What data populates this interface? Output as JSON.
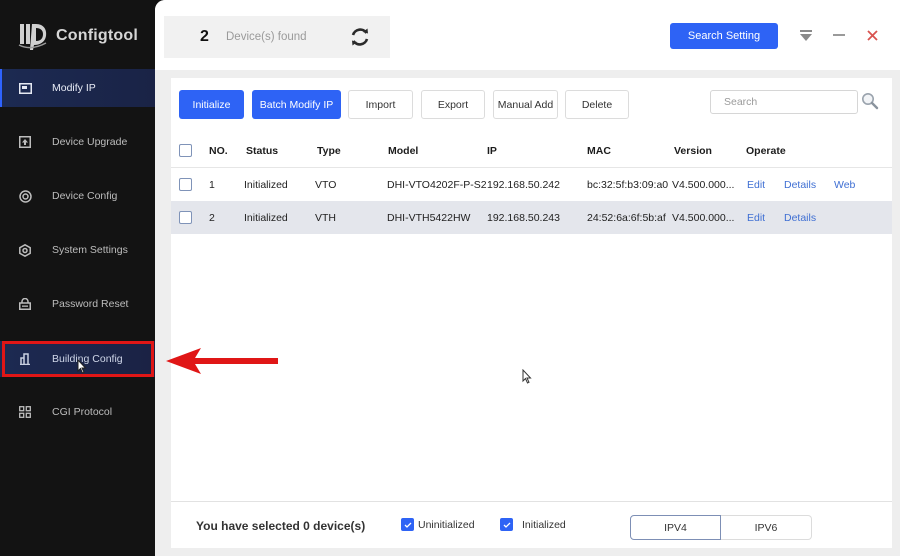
{
  "app": {
    "title": "Configtool"
  },
  "sidebar": {
    "items": [
      {
        "label": "Modify IP",
        "icon": "modify-ip-icon",
        "state": "active"
      },
      {
        "label": "Device Upgrade",
        "icon": "upgrade-icon",
        "state": "normal"
      },
      {
        "label": "Device Config",
        "icon": "device-config-icon",
        "state": "normal"
      },
      {
        "label": "System Settings",
        "icon": "system-settings-icon",
        "state": "normal"
      },
      {
        "label": "Password Reset",
        "icon": "lock-icon",
        "state": "normal"
      },
      {
        "label": "Building Config",
        "icon": "building-icon",
        "state": "hover-highlighted"
      },
      {
        "label": "CGI Protocol",
        "icon": "cgi-protocol-icon",
        "state": "normal"
      }
    ]
  },
  "topbar": {
    "device_count": "2",
    "device_count_label": "Device(s) found",
    "search_setting_label": "Search Setting"
  },
  "toolbar": {
    "initialize": "Initialize",
    "batch_modify_ip": "Batch Modify IP",
    "import": "Import",
    "export": "Export",
    "manual_add": "Manual Add",
    "delete": "Delete",
    "search_placeholder": "Search",
    "search_value": ""
  },
  "table": {
    "columns": [
      "NO.",
      "Status",
      "Type",
      "Model",
      "IP",
      "MAC",
      "Version",
      "Operate"
    ],
    "rows": [
      {
        "no": "1",
        "status": "Initialized",
        "type": "VTO",
        "model": "DHI-VTO4202F-P-S2",
        "ip": "192.168.50.242",
        "mac": "bc:32:5f:b3:09:a0",
        "version": "V4.500.000...",
        "ops": [
          "Edit",
          "Details",
          "Web"
        ],
        "checked": false
      },
      {
        "no": "2",
        "status": "Initialized",
        "type": "VTH",
        "model": "DHI-VTH5422HW",
        "ip": "192.168.50.243",
        "mac": "24:52:6a:6f:5b:af",
        "version": "V4.500.000...",
        "ops": [
          "Edit",
          "Details"
        ],
        "checked": false
      }
    ]
  },
  "footer": {
    "selected_text": "You have selected 0  device(s)",
    "filters": [
      {
        "label": "Uninitialized",
        "checked": true
      },
      {
        "label": "Initialized",
        "checked": true
      }
    ],
    "ip_versions": [
      {
        "label": "IPV4",
        "selected": true
      },
      {
        "label": "IPV6",
        "selected": false
      }
    ]
  },
  "colors": {
    "accent": "#2e63f5",
    "sidebar_bg": "#131313",
    "active_nav": "#1c2a52",
    "annotation_red": "#e01616",
    "link": "#3f6fd3",
    "close_red": "#d9534f"
  }
}
